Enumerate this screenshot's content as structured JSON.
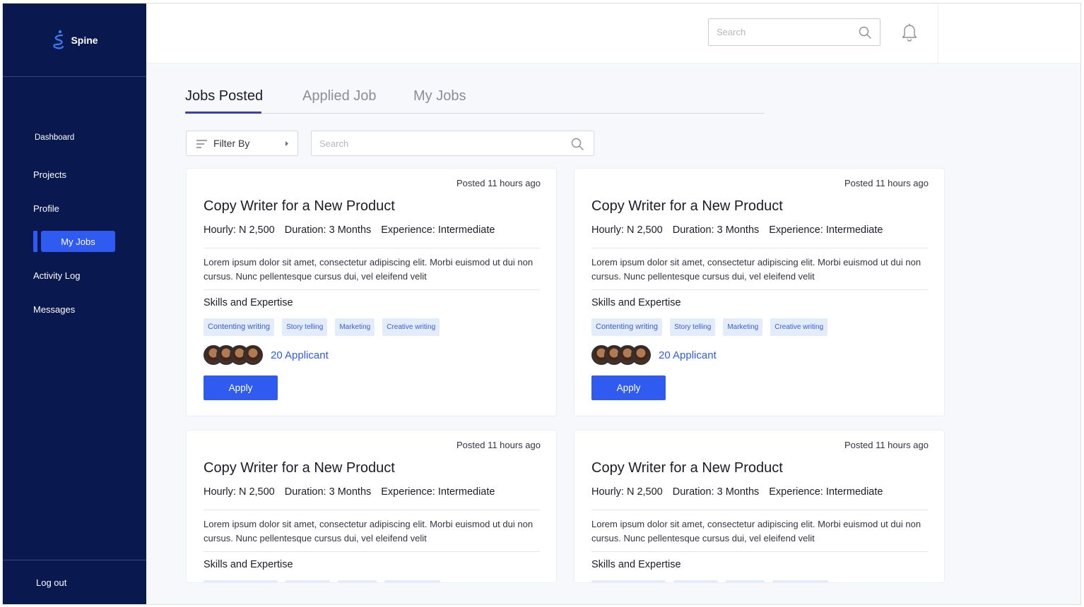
{
  "app": {
    "name": "Spine"
  },
  "sidebar": {
    "items": [
      {
        "label": "Dashboard"
      },
      {
        "label": "Projects"
      },
      {
        "label": "Profile"
      },
      {
        "label": "My Jobs",
        "active": true
      },
      {
        "label": "Activity Log"
      },
      {
        "label": "Messages"
      }
    ],
    "logout": "Log out"
  },
  "header": {
    "search_placeholder": "Search"
  },
  "tabs": [
    {
      "label": "Jobs Posted",
      "active": true
    },
    {
      "label": "Applied Job"
    },
    {
      "label": "My Jobs"
    }
  ],
  "filter": {
    "label": "Filter By"
  },
  "list_search": {
    "placeholder": "Search"
  },
  "jobs": [
    {
      "posted": "Posted 11 hours ago",
      "title": "Copy Writer for a New Product",
      "hourly": "Hourly: N 2,500",
      "duration": "Duration: 3 Months",
      "experience": "Experience: Intermediate",
      "description": "Lorem ipsum dolor sit amet, consectetur adipiscing elit. Morbi euismod ut dui non cursus. Nunc pellentesque cursus dui, vel eleifend velit",
      "skills_title": "Skills and Expertise",
      "skills": [
        "Contenting writing",
        "Story telling",
        "Marketing",
        "Creative writing"
      ],
      "applicants": "20 Applicant",
      "apply": "Apply"
    },
    {
      "posted": "Posted 11 hours ago",
      "title": "Copy Writer for a New Product",
      "hourly": "Hourly: N 2,500",
      "duration": "Duration: 3 Months",
      "experience": "Experience: Intermediate",
      "description": "Lorem ipsum dolor sit amet, consectetur adipiscing elit. Morbi euismod ut dui non cursus. Nunc pellentesque cursus dui, vel eleifend velit",
      "skills_title": "Skills and Expertise",
      "skills": [
        "Contenting writing",
        "Story telling",
        "Marketing",
        "Creative writing"
      ],
      "applicants": "20 Applicant",
      "apply": "Apply"
    },
    {
      "posted": "Posted 11 hours ago",
      "title": "Copy Writer for a New Product",
      "hourly": "Hourly: N 2,500",
      "duration": "Duration: 3 Months",
      "experience": "Experience: Intermediate",
      "description": "Lorem ipsum dolor sit amet, consectetur adipiscing elit. Morbi euismod ut dui non cursus. Nunc pellentesque cursus dui, vel eleifend velit",
      "skills_title": "Skills and Expertise"
    },
    {
      "posted": "Posted 11 hours ago",
      "title": "Copy Writer for a New Product",
      "hourly": "Hourly: N 2,500",
      "duration": "Duration: 3 Months",
      "experience": "Experience: Intermediate",
      "description": "Lorem ipsum dolor sit amet, consectetur adipiscing elit. Morbi euismod ut dui non cursus. Nunc pellentesque cursus dui, vel eleifend velit",
      "skills_title": "Skills and Expertise"
    }
  ],
  "colors": {
    "sidebar": "#0a1850",
    "accent": "#2f5bf0",
    "chip_bg": "#e3ecfb",
    "tab_underline": "#3a3fb8"
  },
  "icons": [
    "spine-logo-icon",
    "search-icon",
    "bell-icon",
    "filter-icon",
    "caret-right-icon"
  ]
}
